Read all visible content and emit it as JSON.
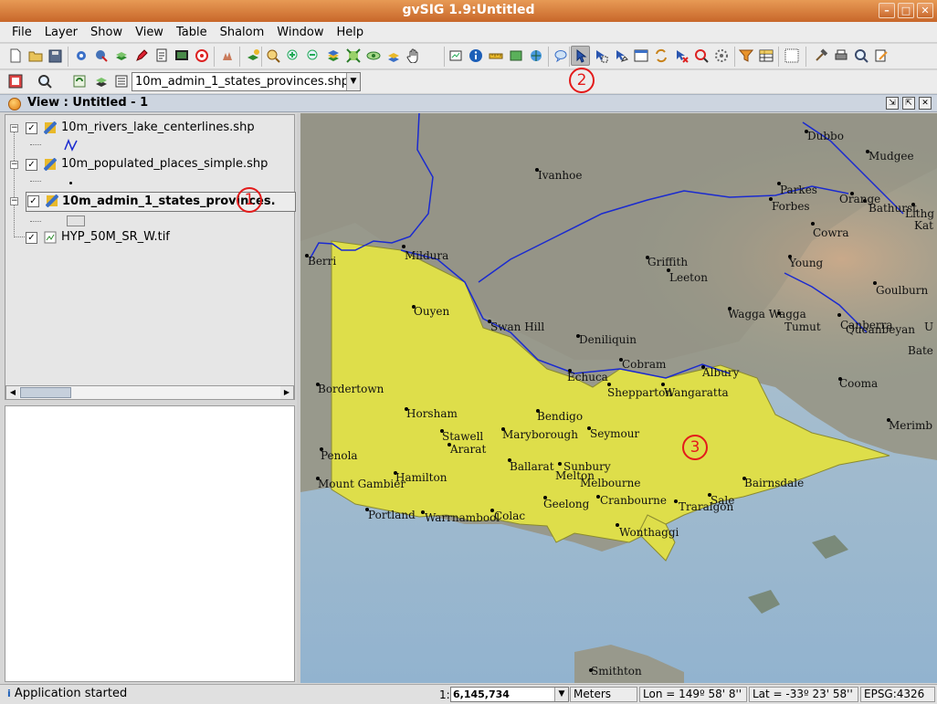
{
  "window": {
    "title": "gvSIG 1.9:Untitled",
    "buttons": [
      "–",
      "□",
      "✕"
    ]
  },
  "menubar": [
    "File",
    "Layer",
    "Show",
    "View",
    "Table",
    "Shalom",
    "Window",
    "Help"
  ],
  "toolbar": {
    "active_tool": "select-by-point",
    "layer_selector_value": "10m_admin_1_states_provinces.shp"
  },
  "view": {
    "title": "View : Untitled - 1"
  },
  "layers": [
    {
      "name": "10m_rivers_lake_centerlines.shp",
      "checked": true,
      "bold": false
    },
    {
      "name": "10m_populated_places_simple.shp",
      "checked": true,
      "bold": false
    },
    {
      "name": "10m_admin_1_states_provinces.shp",
      "checked": true,
      "bold": true
    },
    {
      "name": "HYP_50M_SR_W.tif",
      "checked": true,
      "bold": false
    }
  ],
  "markers": [
    "1",
    "2",
    "3"
  ],
  "map_places": [
    "Dubbo",
    "Mudgee",
    "Ivanhoe",
    "Parkes",
    "Forbes",
    "Orange",
    "Bathurst",
    "Lithg",
    "Kat",
    "Cowra",
    "Berri",
    "Mildura",
    "Griffith",
    "Leeton",
    "Young",
    "Goulburn",
    "Ouyen",
    "Swan Hill",
    "Wagga Wagga",
    "Tumut",
    "Canberra",
    "Queanbeyan",
    "U",
    "Deniliquin",
    "Bate",
    "Cobram",
    "Echuca",
    "Albury",
    "Shepparton",
    "Wangaratta",
    "Cooma",
    "Bordertown",
    "Horsham",
    "Bendigo",
    "Stawell",
    "Maryborough",
    "Seymour",
    "Merimb",
    "Ararat",
    "Penola",
    "Ballarat",
    "Sunbury",
    "Melton",
    "Melbourne",
    "Hamilton",
    "Mount Gambier",
    "Bairnsdale",
    "Geelong",
    "Cranbourne",
    "Sale",
    "Traralgon",
    "Portland",
    "Warrnambool",
    "Colac",
    "Wonthaggi",
    "Smithton"
  ],
  "status": {
    "message": "Application started",
    "scale_prefix": "1:",
    "scale": "6,145,734",
    "units": "Meters",
    "lon": "Lon = 149º 58' 8''",
    "lat": "Lat = -33º 23' 58''",
    "epsg": "EPSG:4326"
  }
}
